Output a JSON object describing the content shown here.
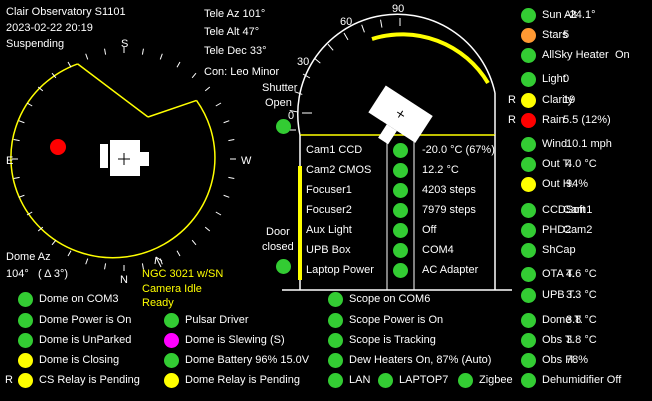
{
  "header": {
    "title": "Clair Observatory  S1101",
    "datetime": "2023-02-22  20:19",
    "state": "Suspending"
  },
  "telescope": {
    "az": "Tele Az 101°",
    "alt": "Tele Alt 47°",
    "dec": "Tele Dec 33°",
    "con": "Con: Leo Minor"
  },
  "compass": {
    "n": "N",
    "s": "S",
    "e": "E",
    "w": "W"
  },
  "dome": {
    "az_label": "Dome Az",
    "az_value": "104°",
    "az_delta": "( Δ 3°)"
  },
  "target": {
    "name": "NGC 3021 w/SN",
    "camera": "Camera Idle",
    "status": "Ready"
  },
  "altitude_scale": {
    "t0": "0",
    "t30": "30",
    "t60": "60",
    "t90": "90"
  },
  "shutter": {
    "label1": "Shutter",
    "label2": "Open"
  },
  "door": {
    "label1": "Door",
    "label2": "closed"
  },
  "devices": [
    {
      "label": "Cam1 CCD",
      "value": "-20.0 °C (67%)"
    },
    {
      "label": "Cam2 CMOS",
      "value": "12.2 °C"
    },
    {
      "label": "Focuser1",
      "value": "4203 steps"
    },
    {
      "label": "Focuser2",
      "value": "7979 steps"
    },
    {
      "label": "Aux Light",
      "value": "Off"
    },
    {
      "label": "UPB Box",
      "value": "COM4"
    },
    {
      "label": "Laptop Power",
      "value": "AC Adapter"
    }
  ],
  "weather": [
    {
      "label": "Sun Alt",
      "value": "-24.1°",
      "color": "#33cc33",
      "prefix": ""
    },
    {
      "label": "Stars",
      "value": "5",
      "color": "#ff9933",
      "prefix": ""
    },
    {
      "label": "AllSky Heater",
      "value": "On",
      "color": "#33cc33",
      "prefix": ""
    },
    {
      "label": "Light",
      "value": "0",
      "color": "#33cc33",
      "prefix": ""
    },
    {
      "label": "Clarity",
      "value": "19",
      "color": "#ffff00",
      "prefix": "R"
    },
    {
      "label": "Rain",
      "value": "5.5  (12%)",
      "color": "#ff0000",
      "prefix": "R"
    },
    {
      "label": "Wind",
      "value": "10.1 mph",
      "color": "#33cc33",
      "prefix": ""
    },
    {
      "label": "Out T.",
      "value": "4.0 °C",
      "color": "#33cc33",
      "prefix": ""
    },
    {
      "label": "Out H.",
      "value": "94%",
      "color": "#ffff00",
      "prefix": ""
    },
    {
      "label": "CCDSoft",
      "value": "Cam1",
      "color": "#33cc33",
      "prefix": ""
    },
    {
      "label": "PHD2",
      "value": "Cam2",
      "color": "#33cc33",
      "prefix": ""
    },
    {
      "label": "ShCap",
      "value": "",
      "color": "#33cc33",
      "prefix": ""
    },
    {
      "label": "OTA T.",
      "value": "4.6 °C",
      "color": "#33cc33",
      "prefix": ""
    },
    {
      "label": "UPB T.",
      "value": "3.3 °C",
      "color": "#33cc33",
      "prefix": ""
    },
    {
      "label": "Dome T.",
      "value": "3.8 °C",
      "color": "#33cc33",
      "prefix": ""
    },
    {
      "label": "Obs T.",
      "value": "3.8 °C",
      "color": "#33cc33",
      "prefix": ""
    },
    {
      "label": "Obs H.",
      "value": "78%",
      "color": "#33cc33",
      "prefix": ""
    },
    {
      "label": "Dehumidifier Off",
      "value": "",
      "color": "#33cc33",
      "prefix": ""
    }
  ],
  "bottom": {
    "dome_com": {
      "label": "Dome on COM3",
      "color": "#33cc33"
    },
    "dome_power": {
      "label": "Dome Power is On",
      "color": "#33cc33"
    },
    "dome_unparked": {
      "label": "Dome is UnParked",
      "color": "#33cc33"
    },
    "dome_closing": {
      "label": "Dome is Closing",
      "color": "#ffff00"
    },
    "cs_relay": {
      "label": "CS Relay is Pending",
      "color": "#ffff00",
      "prefix": "R"
    },
    "pulsar": {
      "label": "Pulsar Driver",
      "color": "#33cc33"
    },
    "dome_slewing": {
      "label": "Dome is Slewing (S)",
      "color": "#ff00ff"
    },
    "dome_battery": {
      "label": "Dome Battery 96%  15.0V",
      "color": "#33cc33"
    },
    "dome_relay": {
      "label": "Dome Relay is Pending",
      "color": "#ffff00"
    },
    "scope_com": {
      "label": "Scope on COM6",
      "color": "#33cc33"
    },
    "scope_power": {
      "label": "Scope Power is On",
      "color": "#33cc33"
    },
    "scope_tracking": {
      "label": "Scope is Tracking",
      "color": "#33cc33"
    },
    "dew_heaters": {
      "label": "Dew Heaters On, 87% (Auto)",
      "color": "#33cc33"
    },
    "lan": {
      "label": "LAN",
      "color": "#33cc33"
    },
    "laptop": {
      "label": "LAPTOP7",
      "color": "#33cc33"
    },
    "zigbee": {
      "label": "Zigbee",
      "color": "#33cc33"
    }
  },
  "colors": {
    "green": "#33cc33",
    "yellow": "#ffff00",
    "red": "#ff0000",
    "orange": "#ff9933",
    "magenta": "#ff00ff"
  }
}
